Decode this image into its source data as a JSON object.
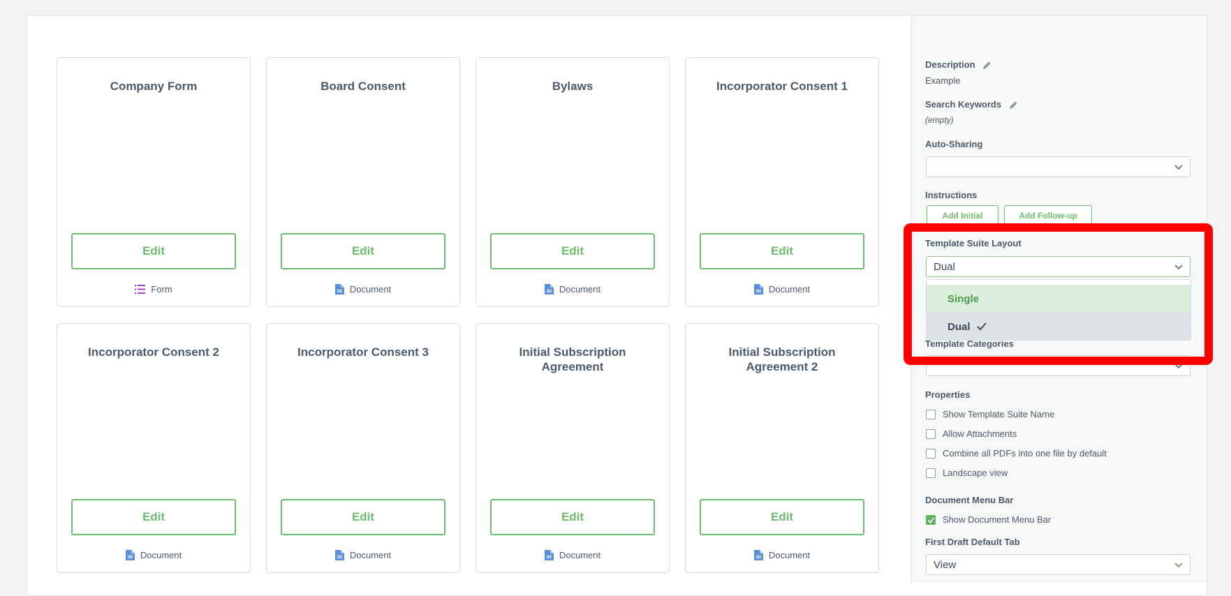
{
  "cards": [
    {
      "title": "Company Form",
      "edit": "Edit",
      "type": "Form",
      "icon": "form-list-icon"
    },
    {
      "title": "Board Consent",
      "edit": "Edit",
      "type": "Document",
      "icon": "document-icon"
    },
    {
      "title": "Bylaws",
      "edit": "Edit",
      "type": "Document",
      "icon": "document-icon"
    },
    {
      "title": "Incorporator Consent 1",
      "edit": "Edit",
      "type": "Document",
      "icon": "document-icon"
    },
    {
      "title": "Incorporator Consent 2",
      "edit": "Edit",
      "type": "Document",
      "icon": "document-icon"
    },
    {
      "title": "Incorporator Consent 3",
      "edit": "Edit",
      "type": "Document",
      "icon": "document-icon"
    },
    {
      "title": "Initial Subscription Agreement",
      "edit": "Edit",
      "type": "Document",
      "icon": "document-icon"
    },
    {
      "title": "Initial Subscription Agreement 2",
      "edit": "Edit",
      "type": "Document",
      "icon": "document-icon"
    }
  ],
  "sidebar": {
    "description_label": "Description",
    "description_value": "Example",
    "keywords_label": "Search Keywords",
    "keywords_value": "(empty)",
    "auto_sharing_label": "Auto-Sharing",
    "auto_sharing_value": "",
    "instructions_label": "Instructions",
    "add_initial": "Add Initial",
    "add_followup": "Add Follow-up",
    "layout_label": "Template Suite Layout",
    "layout_value": "Dual",
    "layout_options": [
      {
        "label": "Single",
        "selected": false
      },
      {
        "label": "Dual",
        "selected": true
      }
    ],
    "categories_label": "Template Categories",
    "properties_label": "Properties",
    "properties": [
      {
        "label": "Show Template Suite Name",
        "checked": false
      },
      {
        "label": "Allow Attachments",
        "checked": false
      },
      {
        "label": "Combine all PDFs into one file by default",
        "checked": false
      },
      {
        "label": "Landscape view",
        "checked": false
      }
    ],
    "menu_bar_label": "Document Menu Bar",
    "menu_bar_option": {
      "label": "Show Document Menu Bar",
      "checked": true
    },
    "first_draft_label": "First Draft Default Tab",
    "first_draft_value": "View"
  },
  "colors": {
    "accent_green": "#6dbb6d",
    "highlight_red": "#ff0000",
    "form_icon": "#a040c0",
    "doc_icon": "#5b8fd9"
  }
}
